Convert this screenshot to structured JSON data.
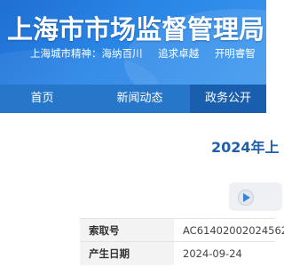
{
  "header": {
    "site_title": "上海市市场监督管理局",
    "slogan": {
      "prefix": "上海城市精神：海纳百川",
      "part2": "追求卓越",
      "part3": "开明睿智"
    }
  },
  "nav": {
    "items": [
      {
        "label": "首页"
      },
      {
        "label": "新闻动态"
      },
      {
        "label": "政务公开"
      }
    ],
    "active_index": 2
  },
  "main": {
    "heading": "2024年上",
    "info": [
      {
        "label": "索取号",
        "value": "AC61402002024562"
      },
      {
        "label": "产生日期",
        "value": "2024-09-24"
      }
    ]
  },
  "icons": {
    "play": "play-icon"
  },
  "colors": {
    "header_blue": "#2a86e6",
    "nav_blue": "#2677c9",
    "nav_active": "#1a5fae",
    "heading_blue": "#1f5fae"
  }
}
